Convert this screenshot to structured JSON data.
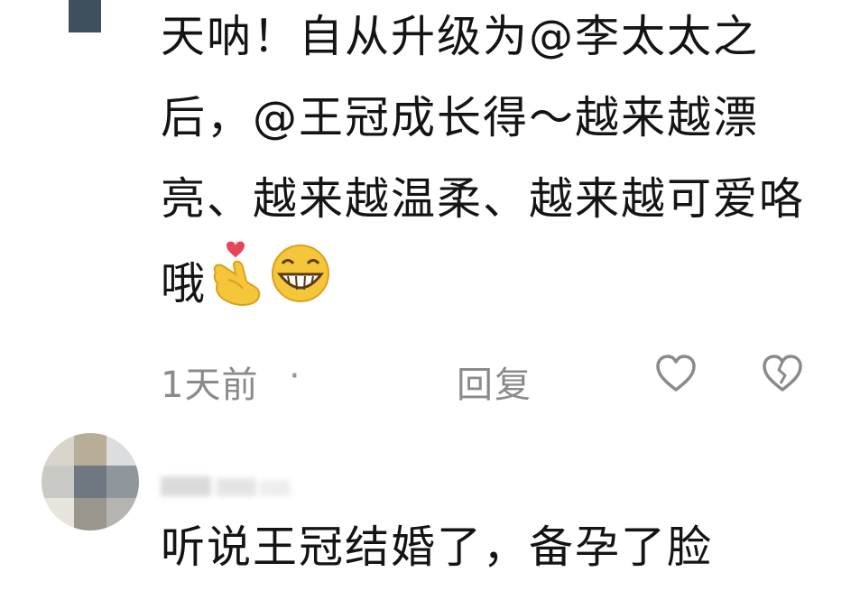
{
  "comment1": {
    "text": "天呐！自从升级为@李太太之后，@王冠成长得～越来越漂亮、越来越温柔、越来越可爱咯哦",
    "emojis": [
      "finger-heart-emoji",
      "grinning-face-emoji"
    ],
    "time": "1天前",
    "separator": "·",
    "reply_label": "回复",
    "actions": [
      "like-heart-icon",
      "broken-heart-icon"
    ]
  },
  "comment2": {
    "text": "听说王冠结婚了，备孕了脸"
  },
  "colors": {
    "text": "#141414",
    "meta": "#8a8a8a",
    "icon": "#8a8a8a",
    "emoji_yellow": "#f5c53a",
    "heart_red": "#e8455a"
  }
}
